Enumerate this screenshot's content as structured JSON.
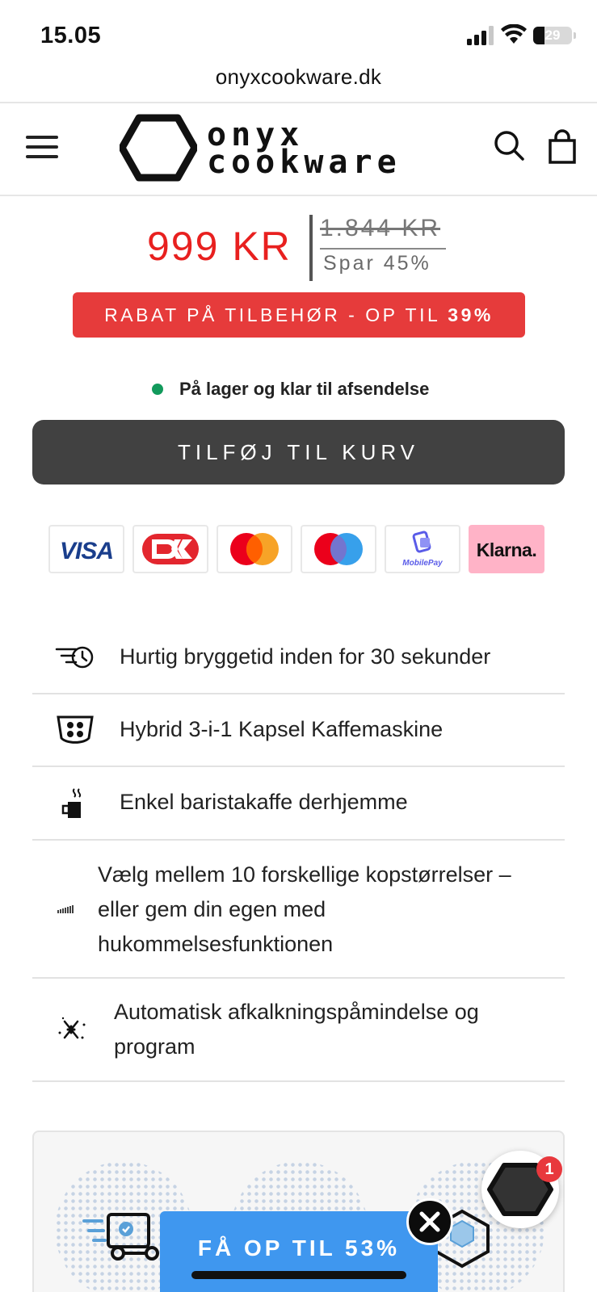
{
  "status_bar": {
    "time": "15.05",
    "battery": "29",
    "battery_level": 0.29
  },
  "browser": {
    "url": "onyxcookware.dk"
  },
  "header": {
    "logo_line1": "onyx",
    "logo_line2": "cookware"
  },
  "price": {
    "current": "999 KR",
    "original": "1.844 KR",
    "saving": "Spar 45%"
  },
  "promo_banner": {
    "text": "RABAT PÅ TILBEHØR - OP TIL ",
    "highlight": "39%"
  },
  "stock": {
    "text": "På lager og klar til afsendelse",
    "color": "#129a5c"
  },
  "cart": {
    "button_label": "TILFØJ TIL KURV"
  },
  "payment_methods": {
    "visa": "VISA",
    "mobilepay": "MobilePay",
    "klarna": "Klarna.",
    "icons": [
      "visa-logo",
      "dankort-logo",
      "mastercard-logo",
      "maestro-logo",
      "mobilepay-logo",
      "klarna-logo"
    ]
  },
  "features": [
    {
      "icon": "fast-clock-icon",
      "line1": "Hurtig bryggetid inden for 30 sekunder"
    },
    {
      "icon": "capsule-holder-icon",
      "line1": "Hybrid 3-i-1 Kapsel Kaffemaskine"
    },
    {
      "icon": "coffee-cup-icon",
      "line1": "Enkel baristakaffe derhjemme"
    },
    {
      "icon": "cup-size-icon",
      "line1": "Vælg mellem 10 forskellige kopstørrelser –",
      "line2": "eller gem din egen med",
      "line3": "hukommelsesfunktionen"
    },
    {
      "icon": "sparkle-icon",
      "line1": "Automatisk afkalkningspåmindelse og",
      "line2": "program"
    }
  ],
  "sticky_offer": {
    "label": "FÅ OP TIL 53%"
  },
  "chat": {
    "badge_count": "1"
  },
  "colors": {
    "price_red": "#e8201f",
    "banner_red": "#e63b3b",
    "cart_button": "#414141",
    "offer_blue": "#3f97ef"
  }
}
